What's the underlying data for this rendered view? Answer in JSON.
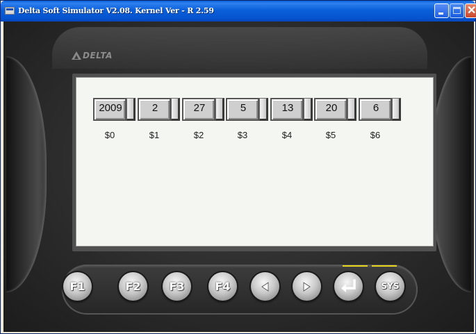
{
  "window": {
    "title": "Delta Soft Simulator V2.08. Kernel Ver - R 2.59"
  },
  "device": {
    "brand": "DELTA"
  },
  "screen": {
    "fields": [
      {
        "value": "2009",
        "label": "$0"
      },
      {
        "value": "2",
        "label": "$1"
      },
      {
        "value": "27",
        "label": "$2"
      },
      {
        "value": "5",
        "label": "$3"
      },
      {
        "value": "13",
        "label": "$4"
      },
      {
        "value": "20",
        "label": "$5"
      },
      {
        "value": "6",
        "label": "$6"
      }
    ]
  },
  "keypad": {
    "keys": [
      {
        "label": "F1",
        "icon": "f1-key"
      },
      {
        "label": "F2",
        "icon": "f2-key"
      },
      {
        "label": "F3",
        "icon": "f3-key"
      },
      {
        "label": "F4",
        "icon": "f4-key"
      },
      {
        "label": "",
        "icon": "arrow-left-icon"
      },
      {
        "label": "",
        "icon": "arrow-right-icon"
      },
      {
        "label": "",
        "icon": "enter-icon"
      },
      {
        "label": "SYS",
        "icon": "sys-key"
      }
    ],
    "led_color": "#e6d31a"
  }
}
